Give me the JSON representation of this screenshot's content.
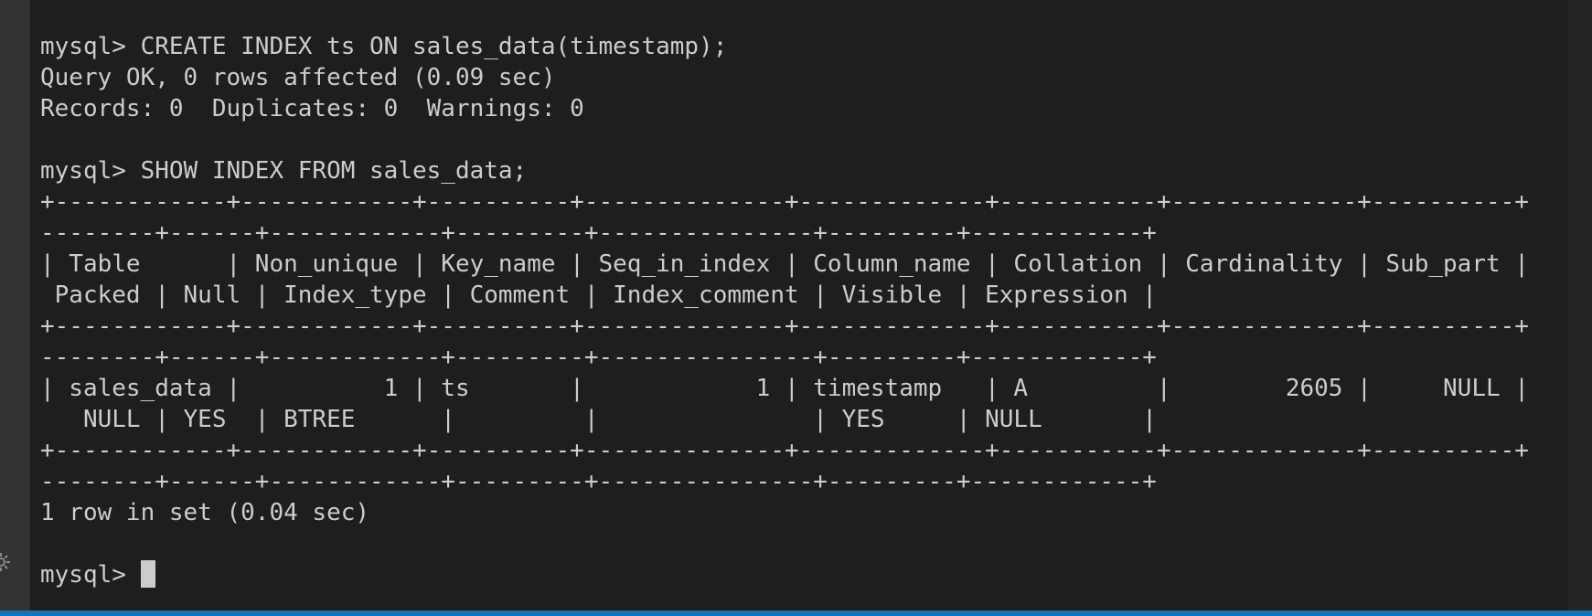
{
  "terminal": {
    "lines": [
      "mysql> CREATE INDEX ts ON sales_data(timestamp);",
      "Query OK, 0 rows affected (0.09 sec)",
      "Records: 0  Duplicates: 0  Warnings: 0",
      "",
      "mysql> SHOW INDEX FROM sales_data;",
      "+------------+------------+----------+--------------+-------------+-----------+-------------+----------+",
      "--------+------+------------+---------+---------------+---------+------------+",
      "| Table      | Non_unique | Key_name | Seq_in_index | Column_name | Collation | Cardinality | Sub_part |",
      " Packed | Null | Index_type | Comment | Index_comment | Visible | Expression |",
      "+------------+------------+----------+--------------+-------------+-----------+-------------+----------+",
      "--------+------+------------+---------+---------------+---------+------------+",
      "| sales_data |          1 | ts       |            1 | timestamp   | A         |        2605 |     NULL |",
      "   NULL | YES  | BTREE      |         |               | YES     | NULL       |",
      "+------------+------------+----------+--------------+-------------+-----------+-------------+----------+",
      "--------+------+------------+---------+---------------+---------+------------+",
      "1 row in set (0.04 sec)",
      ""
    ],
    "prompt": "mysql> "
  },
  "colors": {
    "background": "#1e1e1e",
    "text": "#cccccc",
    "accent": "#007acc"
  },
  "icons": {
    "left_edge": "gear-icon"
  }
}
